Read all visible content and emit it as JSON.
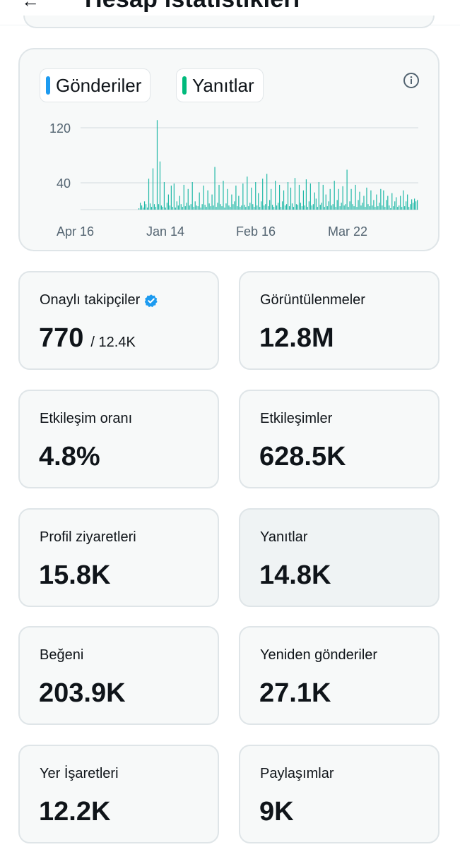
{
  "header": {
    "title": "Hesap istatistikleri",
    "back_icon": "arrow-left-icon"
  },
  "chart": {
    "legend": [
      {
        "label": "Gönderiler",
        "color": "#1d9bf0"
      },
      {
        "label": "Yanıtlar",
        "color": "#00ba7c"
      }
    ],
    "info_icon": "info-icon"
  },
  "chart_data": {
    "type": "bar",
    "x_ticks": [
      "Apr 16",
      "Jan 14",
      "Feb 16",
      "Mar 22"
    ],
    "y_ticks": [
      120,
      40
    ],
    "ylim": [
      0,
      140
    ],
    "bar_color": "#1fb8a6",
    "series": [
      {
        "values": [
          2,
          10,
          6,
          3,
          12,
          8,
          3,
          45,
          9,
          4,
          60,
          8,
          4,
          130,
          8,
          70,
          6,
          4,
          40,
          3,
          10,
          22,
          6,
          35,
          4,
          38,
          3,
          12,
          6,
          20,
          8,
          4,
          36,
          5,
          10,
          30,
          6,
          8,
          40,
          4,
          12,
          6,
          5,
          25,
          3,
          8,
          35,
          7,
          4,
          28,
          9,
          5,
          22,
          6,
          62,
          4,
          10,
          36,
          8,
          5,
          42,
          3,
          9,
          30,
          6,
          4,
          22,
          8,
          12,
          35,
          5,
          20,
          4,
          6,
          38,
          7,
          4,
          48,
          5,
          10,
          32,
          8,
          4,
          40,
          6,
          24,
          4,
          12,
          45,
          6,
          8,
          52,
          5,
          14,
          30,
          7,
          4,
          42,
          6,
          10,
          36,
          4,
          12,
          28,
          6,
          8,
          40,
          5,
          32,
          9,
          4,
          46,
          8,
          7,
          36,
          10,
          5,
          28,
          6,
          44,
          4,
          12,
          38,
          6,
          8,
          25,
          16,
          4,
          40,
          7,
          10,
          36,
          4,
          22,
          5,
          12,
          30,
          6,
          8,
          42,
          4,
          14,
          30,
          5,
          10,
          34,
          6,
          8,
          58,
          4,
          12,
          30,
          8,
          5,
          36,
          4,
          14,
          26,
          6,
          10,
          20,
          4,
          32,
          8,
          5,
          28,
          6,
          14,
          4,
          22,
          5,
          10,
          30,
          6,
          28,
          4,
          14,
          20,
          6,
          2,
          24,
          5,
          12,
          18,
          4,
          6,
          20,
          4,
          28,
          5,
          12,
          22,
          4,
          8,
          15,
          10,
          16,
          12,
          14
        ]
      }
    ]
  },
  "stats": [
    {
      "label": "Onaylı takipçiler",
      "value": "770",
      "sub": "/ 12.4K",
      "icon": "verified-badge-icon"
    },
    {
      "label": "Görüntülenmeler",
      "value": "12.8M"
    },
    {
      "label": "Etkileşim oranı",
      "value": "4.8%"
    },
    {
      "label": "Etkileşimler",
      "value": "628.5K"
    },
    {
      "label": "Profil ziyaretleri",
      "value": "15.8K"
    },
    {
      "label": "Yanıtlar",
      "value": "14.8K"
    },
    {
      "label": "Beğeni",
      "value": "203.9K"
    },
    {
      "label": "Yeniden gönderiler",
      "value": "27.1K"
    },
    {
      "label": "Yer İşaretleri",
      "value": "12.2K"
    },
    {
      "label": "Paylaşımlar",
      "value": "9K"
    }
  ]
}
